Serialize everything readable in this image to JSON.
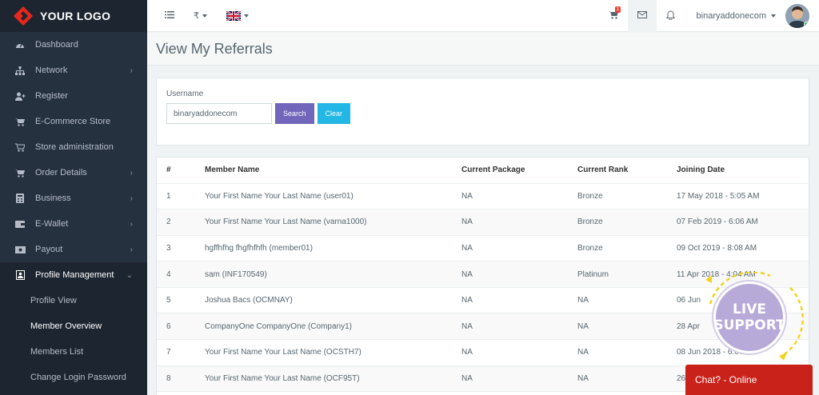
{
  "brand": {
    "logo_text": "YOUR LOGO"
  },
  "sidebar": {
    "items": [
      {
        "label": "Dashboard",
        "icon": "dashboard-icon",
        "has_children": false
      },
      {
        "label": "Network",
        "icon": "sitemap-icon",
        "has_children": true
      },
      {
        "label": "Register",
        "icon": "user-plus-icon",
        "has_children": false
      },
      {
        "label": "E-Commerce Store",
        "icon": "cart-icon",
        "has_children": false
      },
      {
        "label": "Store administration",
        "icon": "cart-outline-icon",
        "has_children": false
      },
      {
        "label": "Order Details",
        "icon": "cart-icon",
        "has_children": true
      },
      {
        "label": "Business",
        "icon": "calculator-icon",
        "has_children": true
      },
      {
        "label": "E-Wallet",
        "icon": "wallet-icon",
        "has_children": true
      },
      {
        "label": "Payout",
        "icon": "money-icon",
        "has_children": true
      },
      {
        "label": "Profile Management",
        "icon": "profile-icon",
        "has_children": true,
        "expanded": true
      }
    ],
    "subitems": [
      {
        "label": "Profile View"
      },
      {
        "label": "Member Overview"
      },
      {
        "label": "Members List"
      },
      {
        "label": "Change Login Password"
      }
    ]
  },
  "topbar": {
    "currency_symbol": "₹",
    "cart_badge": "1",
    "username": "binaryaddonecom"
  },
  "page": {
    "title": "View My Referrals"
  },
  "search": {
    "label": "Username",
    "value": "binaryaddonecom",
    "search_label": "Search",
    "clear_label": "Clear"
  },
  "table": {
    "headers": [
      "#",
      "Member Name",
      "Current Package",
      "Current Rank",
      "Joining Date"
    ],
    "rows": [
      [
        "1",
        "Your First Name Your Last Name (user01)",
        "NA",
        "Bronze",
        "17 May 2018 - 5:05 AM"
      ],
      [
        "2",
        "Your First Name Your Last Name (varna1000)",
        "NA",
        "Bronze",
        "07 Feb 2019 - 6:06 AM"
      ],
      [
        "3",
        "hgffhfhg fhgfhfhfh (member01)",
        "NA",
        "Bronze",
        "09 Oct 2019 - 8:08 AM"
      ],
      [
        "4",
        "sam (INF170549)",
        "NA",
        "Platinum",
        "11 Apr 2018 - 4:04 AM"
      ],
      [
        "5",
        "Joshua Bacs (OCMNAY)",
        "NA",
        "NA",
        "06 Jun"
      ],
      [
        "6",
        "CompanyOne CompanyOne (Company1)",
        "NA",
        "NA",
        "28 Apr"
      ],
      [
        "7",
        "Your First Name Your Last Name (OCSTH7)",
        "NA",
        "NA",
        "08 Jun 2018 - 6:06 AM"
      ],
      [
        "8",
        "Your First Name Your Last Name (OCF95T)",
        "NA",
        "NA",
        "26"
      ]
    ]
  },
  "live_support": {
    "line1": "LIVE",
    "line2": "SUPPORT"
  },
  "chat": {
    "label": "Chat? - Online"
  },
  "colors": {
    "sidebar": "#1d2530",
    "search_button": "#7266ba",
    "clear_button": "#23b7e5",
    "chat": "#c9221b"
  }
}
